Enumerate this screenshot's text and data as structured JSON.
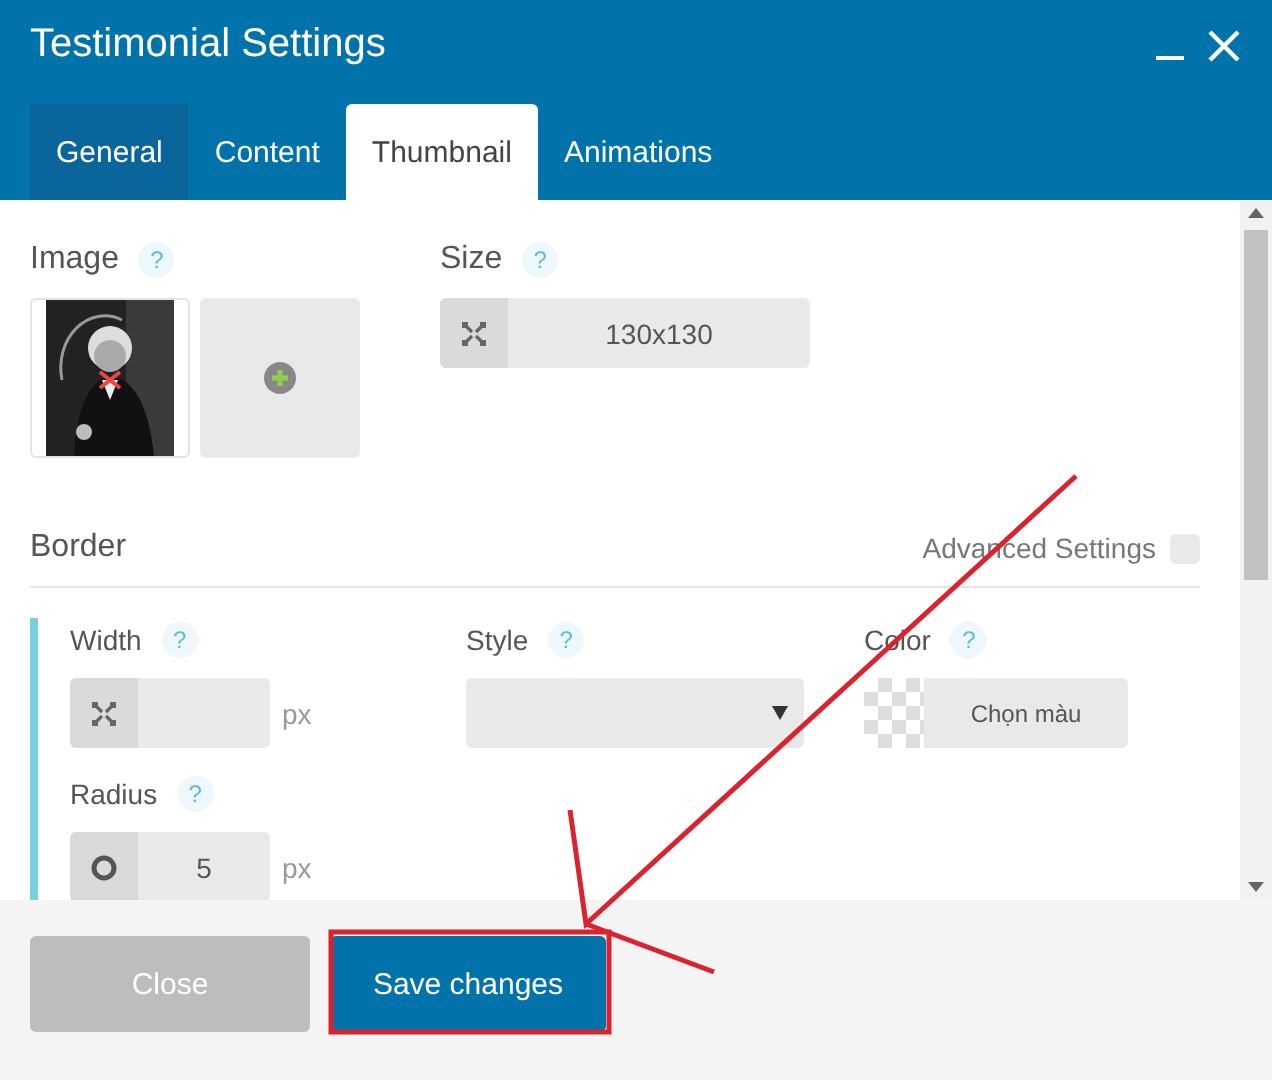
{
  "window": {
    "title": "Testimonial Settings"
  },
  "tabs": [
    {
      "label": "General",
      "selected": false
    },
    {
      "label": "Content",
      "selected": false
    },
    {
      "label": "Thumbnail",
      "selected": true
    },
    {
      "label": "Animations",
      "selected": false
    }
  ],
  "image": {
    "label": "Image",
    "help": "?"
  },
  "size": {
    "label": "Size",
    "help": "?",
    "value": "130x130"
  },
  "border": {
    "heading": "Border",
    "advanced_settings": {
      "label": "Advanced Settings",
      "checked": false
    },
    "fields": [
      {
        "kind": "number",
        "label": "Width",
        "help": "?",
        "unit": "px"
      },
      {
        "kind": "select",
        "label": "Style",
        "help": "?"
      },
      {
        "kind": "color",
        "label": "Color",
        "help": "?",
        "button": "Chọn màu"
      },
      {
        "kind": "radius",
        "label": "Radius",
        "help": "?",
        "value": "5",
        "unit": "px"
      }
    ]
  },
  "footer": {
    "buttons": [
      {
        "label": "Close",
        "kind": "secondary"
      },
      {
        "label": "Save changes",
        "kind": "primary"
      }
    ]
  }
}
